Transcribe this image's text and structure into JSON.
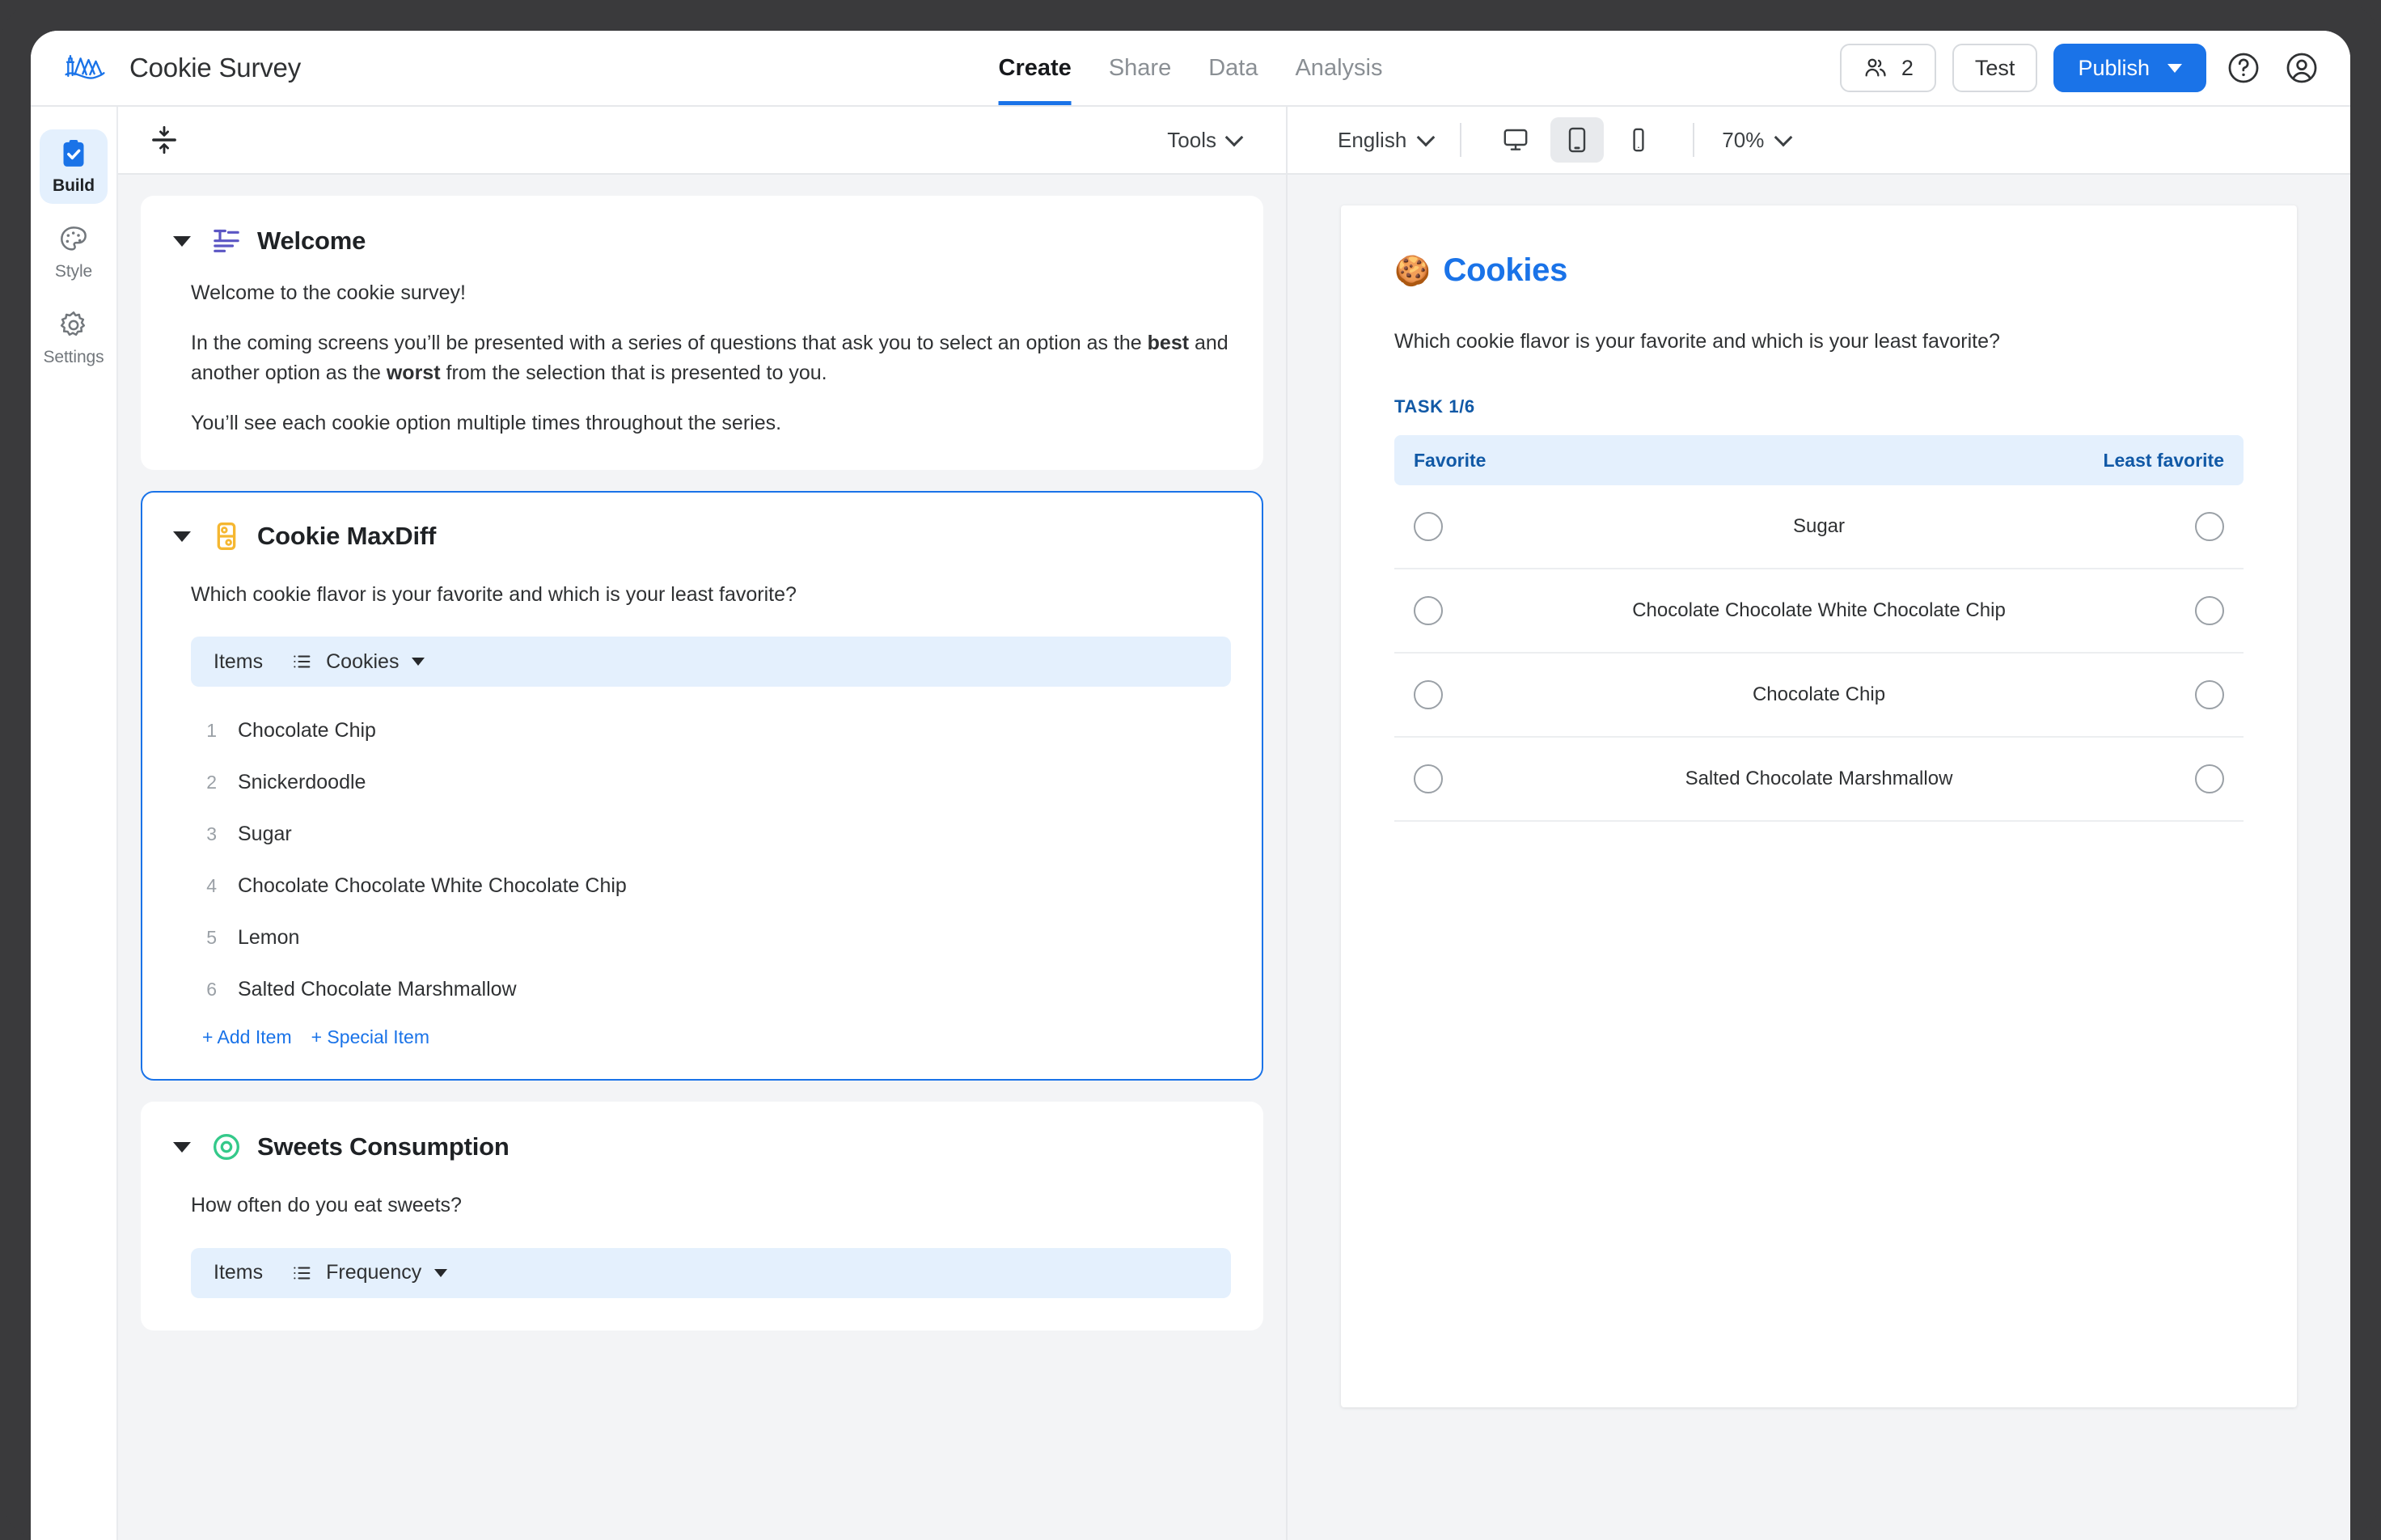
{
  "topbar": {
    "logo_icon": "lighthouse-mountains-logo",
    "app_title": "Cookie Survey",
    "nav": [
      {
        "label": "Create",
        "active": true
      },
      {
        "label": "Share",
        "active": false
      },
      {
        "label": "Data",
        "active": false
      },
      {
        "label": "Analysis",
        "active": false
      }
    ],
    "collaborators_count": "2",
    "test_label": "Test",
    "publish_label": "Publish",
    "help_icon": "question-circle-icon",
    "account_icon": "user-circle-icon"
  },
  "rail": {
    "items": [
      {
        "label": "Build",
        "icon": "clipboard-check-icon",
        "active": true
      },
      {
        "label": "Style",
        "icon": "palette-icon",
        "active": false
      },
      {
        "label": "Settings",
        "icon": "gear-icon",
        "active": false
      }
    ]
  },
  "editor_toolbar": {
    "collapse_icon": "collapse-all-icon",
    "tools_label": "Tools"
  },
  "preview_toolbar": {
    "language": "English",
    "devices": [
      {
        "name": "desktop",
        "active": false
      },
      {
        "name": "tablet",
        "active": true
      },
      {
        "name": "mobile",
        "active": false
      }
    ],
    "zoom": "70%"
  },
  "cards": [
    {
      "title": "Welcome",
      "icon": "text-block-icon",
      "selected": false,
      "paragraphs": [
        {
          "text": "Welcome to the cookie survey!"
        },
        {
          "segments": [
            {
              "t": "In the coming screens you’ll be presented with a series of questions that ask you to select an option as the "
            },
            {
              "t": "best",
              "bold": true
            },
            {
              "t": " and another option as the "
            },
            {
              "t": "worst",
              "bold": true
            },
            {
              "t": " from the selection that is presented to you."
            }
          ]
        },
        {
          "text": "You’ll see each cookie option multiple times throughout the series."
        }
      ]
    },
    {
      "title": "Cookie MaxDiff",
      "icon": "maxdiff-domino-icon",
      "selected": true,
      "question": "Which cookie flavor is your favorite and which is your least favorite?",
      "items_label": "Items",
      "items_list_icon": "list-icon",
      "items_source": "Cookies",
      "items": [
        {
          "num": "1",
          "text": "Chocolate Chip"
        },
        {
          "num": "2",
          "text": "Snickerdoodle"
        },
        {
          "num": "3",
          "text": "Sugar"
        },
        {
          "num": "4",
          "text": "Chocolate Chocolate White Chocolate Chip"
        },
        {
          "num": "5",
          "text": "Lemon"
        },
        {
          "num": "6",
          "text": "Salted Chocolate Marshmallow"
        }
      ],
      "add_item_label": "+ Add Item",
      "special_item_label": "+ Special Item"
    },
    {
      "title": "Sweets Consumption",
      "icon": "radio-circle-icon",
      "selected": false,
      "question": "How often do you eat sweets?",
      "items_label": "Items",
      "items_list_icon": "list-icon",
      "items_source": "Frequency"
    }
  ],
  "preview": {
    "emoji": "🍪",
    "title": "Cookies",
    "question": "Which cookie flavor is your favorite and which is your least favorite?",
    "task_label": "TASK 1/6",
    "col_left": "Favorite",
    "col_right": "Least favorite",
    "rows": [
      {
        "label": "Sugar"
      },
      {
        "label": "Chocolate Chocolate White Chocolate Chip"
      },
      {
        "label": "Chocolate Chip"
      },
      {
        "label": "Salted Chocolate Marshmallow"
      }
    ]
  },
  "colors": {
    "accent": "#1a73e8",
    "accent_soft": "#e4f0fd",
    "welcome_icon": "#5b56c4",
    "maxdiff_icon": "#f5b731",
    "sweets_icon": "#34c98a",
    "page_bg": "#f3f4f6",
    "frame": "#3a3a3c"
  }
}
